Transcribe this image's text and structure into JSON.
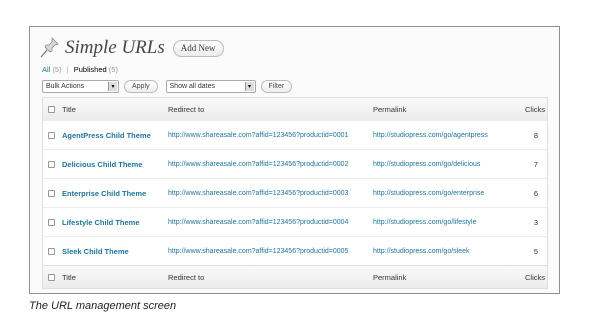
{
  "page": {
    "title": "Simple URLs",
    "add_new_label": "Add New"
  },
  "filters": {
    "all_label": "All",
    "all_count": "(5)",
    "separator": "|",
    "published_label": "Published",
    "published_count": "(5)"
  },
  "toolbar": {
    "bulk_actions_value": "Bulk Actions",
    "apply_label": "Apply",
    "dates_value": "Show all dates",
    "filter_label": "Filter"
  },
  "table": {
    "columns": {
      "title": "Title",
      "redirect": "Redirect to",
      "permalink": "Permalink",
      "clicks": "Clicks"
    },
    "rows": [
      {
        "title": "AgentPress Child Theme",
        "redirect": "http://www.shareasale.com?affid=123456?productid=0001",
        "permalink": "http://studiopress.com/go/agentpress",
        "clicks": "8"
      },
      {
        "title": "Delicious Child Theme",
        "redirect": "http://www.shareasale.com?affid=123456?productid=0002",
        "permalink": "http://studiopress.com/go/delicious",
        "clicks": "7"
      },
      {
        "title": "Enterprise Child Theme",
        "redirect": "http://www.shareasale.com?affid=123456?productid=0003",
        "permalink": "http://studiopress.com/go/enterprise",
        "clicks": "6"
      },
      {
        "title": "Lifestyle Child Theme",
        "redirect": "http://www.shareasale.com?affid=123456?productid=0004",
        "permalink": "http://studiopress.com/go/lifestyle",
        "clicks": "3"
      },
      {
        "title": "Sleek Child Theme",
        "redirect": "http://www.shareasale.com?affid=123456?productid=0005",
        "permalink": "http://studiopress.com/go/sleek",
        "clicks": "5"
      }
    ]
  },
  "caption": "The URL management screen",
  "colors": {
    "link": "#21759b",
    "text": "#333333",
    "border": "#dfdfdf"
  },
  "icons": {
    "page_icon": "pushpin-icon",
    "dropdown_icon": "dropdown-arrow-icon"
  }
}
